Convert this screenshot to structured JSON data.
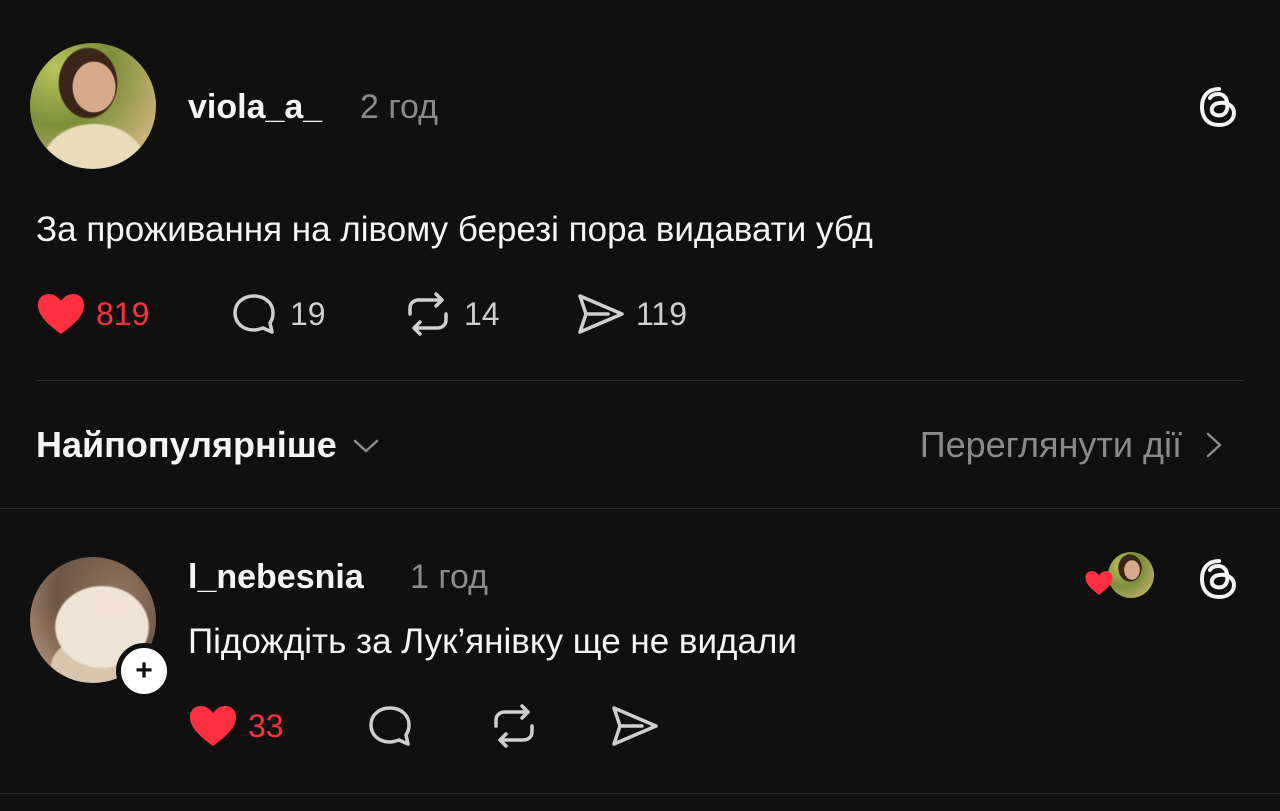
{
  "post": {
    "username": "viola_a_",
    "time": "2 год",
    "text": "За проживання на лівому березі пора видавати убд",
    "likes": "819",
    "replies": "19",
    "reposts": "14",
    "shares": "119"
  },
  "sort": {
    "label": "Найпопулярніше",
    "activity_link": "Переглянути дії"
  },
  "reply": {
    "username": "l_nebesnia",
    "time": "1 год",
    "text": "Підождіть за Лук’янівку ще не видали",
    "likes": "33"
  },
  "icons": {
    "like": "heart-icon",
    "reply": "comment-icon",
    "repost": "repost-icon",
    "share": "send-icon",
    "app": "threads-icon",
    "follow": "plus-icon"
  },
  "colors": {
    "background": "#101010",
    "text": "#f3f5f7",
    "muted": "#8a8a8a",
    "like": "#ff3040"
  }
}
